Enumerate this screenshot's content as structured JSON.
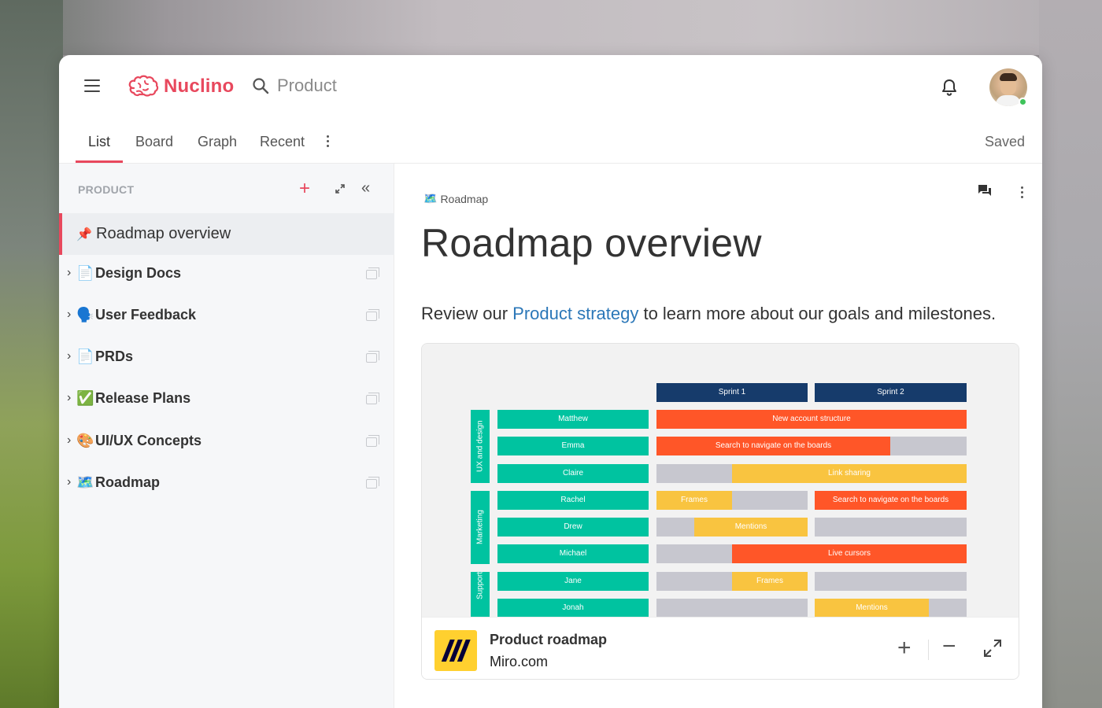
{
  "app": {
    "name": "Nuclino",
    "brand_color": "#e8485d"
  },
  "search": {
    "text": "Product"
  },
  "tabs": [
    {
      "label": "List",
      "active": true
    },
    {
      "label": "Board",
      "active": false
    },
    {
      "label": "Graph",
      "active": false
    },
    {
      "label": "Recent",
      "active": false
    }
  ],
  "status": {
    "saved": "Saved"
  },
  "sidebar": {
    "heading": "PRODUCT",
    "active_item": {
      "icon": "pin-icon",
      "label": "Roadmap overview"
    },
    "items": [
      {
        "emoji": "📄",
        "label": "Design Docs"
      },
      {
        "emoji": "🗣️",
        "label": "User Feedback"
      },
      {
        "emoji": "📄",
        "label": "PRDs"
      },
      {
        "emoji": "✅",
        "label": "Release Plans"
      },
      {
        "emoji": "🎨",
        "label": "UI/UX Concepts"
      },
      {
        "emoji": "🗺️",
        "label": "Roadmap"
      }
    ]
  },
  "content": {
    "breadcrumb": {
      "emoji": "🗺️",
      "label": "Roadmap"
    },
    "title": "Roadmap overview",
    "intro_before": "Review our ",
    "intro_link": "Product strategy",
    "intro_after": " to learn more about our goals and milestones."
  },
  "embed": {
    "title": "Product roadmap",
    "source": "Miro.com",
    "board": {
      "sprints": [
        "Sprint 1",
        "Sprint 2"
      ],
      "groups": [
        "UX and design",
        "Marketing",
        "Support"
      ],
      "people": [
        "Matthew",
        "Emma",
        "Claire",
        "Rachel",
        "Drew",
        "Michael",
        "Jane",
        "Jonah"
      ],
      "tasks": [
        "New account structure",
        "Search to navigate on the boards",
        "Link sharing",
        "Frames",
        "Search to navigate on the boards",
        "Mentions",
        "Live cursors",
        "Frames",
        "Mentions"
      ]
    }
  }
}
